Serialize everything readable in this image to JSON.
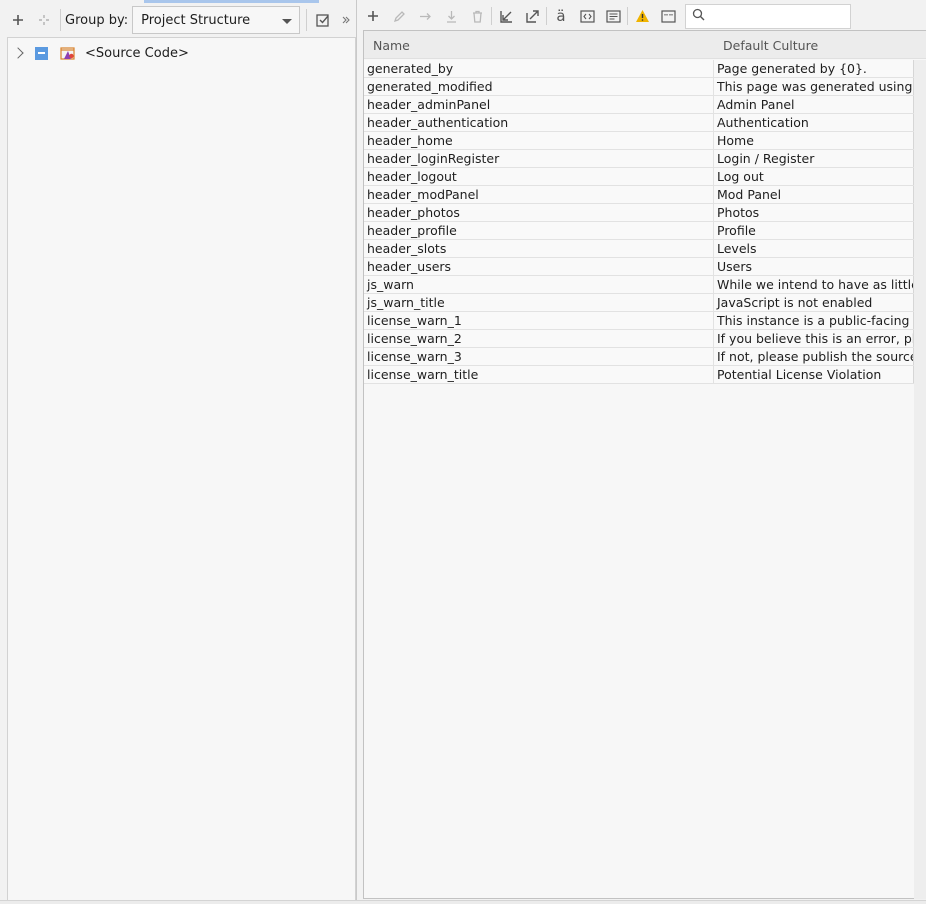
{
  "left_toolbar": {
    "group_by_label": "Group by:",
    "group_by_value": "Project Structure"
  },
  "tree": {
    "items": [
      {
        "label": "<Source Code>"
      }
    ]
  },
  "search": {
    "placeholder": ""
  },
  "grid": {
    "columns": [
      "Name",
      "Default Culture"
    ],
    "rows": [
      {
        "name": "generated_by",
        "value": "Page generated by {0}."
      },
      {
        "name": "generated_modified",
        "value": "This page was generated using a m"
      },
      {
        "name": "header_adminPanel",
        "value": "Admin Panel"
      },
      {
        "name": "header_authentication",
        "value": "Authentication"
      },
      {
        "name": "header_home",
        "value": "Home"
      },
      {
        "name": "header_loginRegister",
        "value": "Login / Register"
      },
      {
        "name": "header_logout",
        "value": "Log out"
      },
      {
        "name": "header_modPanel",
        "value": "Mod Panel"
      },
      {
        "name": "header_photos",
        "value": "Photos"
      },
      {
        "name": "header_profile",
        "value": "Profile"
      },
      {
        "name": "header_slots",
        "value": "Levels"
      },
      {
        "name": "header_users",
        "value": "Users"
      },
      {
        "name": "js_warn",
        "value": "While we intend to have as little J"
      },
      {
        "name": "js_warn_title",
        "value": "JavaScript is not enabled"
      },
      {
        "name": "license_warn_1",
        "value": "This instance is a public-facing ins"
      },
      {
        "name": "license_warn_2",
        "value": "If you believe this is an error, plea"
      },
      {
        "name": "license_warn_3",
        "value": "If not, please publish the source c"
      },
      {
        "name": "license_warn_title",
        "value": "Potential License Violation"
      }
    ]
  },
  "icons": {
    "locale_glyph": "ä"
  },
  "colors": {
    "accent": "#5b9ae0",
    "warning": "#f0b400"
  }
}
